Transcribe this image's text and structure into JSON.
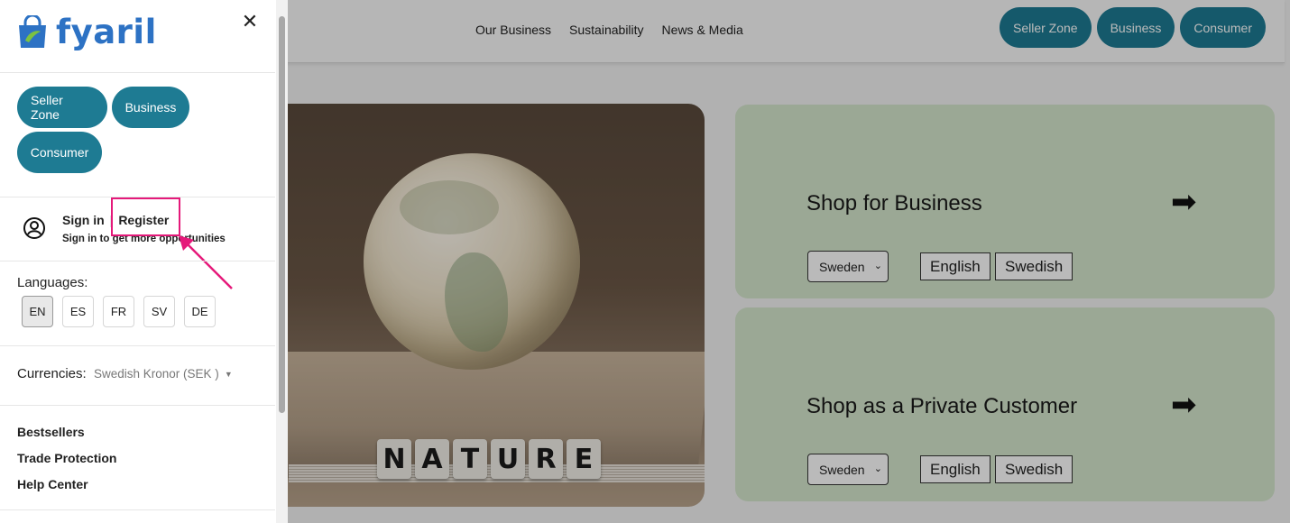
{
  "topnav": {
    "links": [
      "Our Business",
      "Sustainability",
      "News & Media"
    ],
    "zones": [
      "Seller Zone",
      "Business",
      "Consumer"
    ]
  },
  "hero": {
    "dice_letters": [
      "N",
      "A",
      "T",
      "U",
      "R",
      "E"
    ]
  },
  "shop_cards": [
    {
      "title": "Shop for Business",
      "country": "Sweden",
      "lang_en": "English",
      "lang_sv": "Swedish"
    },
    {
      "title": "Shop as a Private Customer",
      "country": "Sweden",
      "lang_en": "English",
      "lang_sv": "Swedish"
    }
  ],
  "drawer": {
    "logo_text": "fyaril",
    "close_glyph": "✕",
    "zones": {
      "seller": "Seller Zone",
      "business": "Business",
      "consumer": "Consumer"
    },
    "signin": "Sign in",
    "separator": "|",
    "register": "Register",
    "signin_sub": "Sign in to get more opportunities",
    "languages_title": "Languages:",
    "languages": [
      "EN",
      "ES",
      "FR",
      "SV",
      "DE"
    ],
    "active_language": "EN",
    "currencies_label": "Currencies:",
    "currency_value": "Swedish Kronor (SEK )",
    "links": [
      "Bestsellers",
      "Trade Protection",
      "Help Center"
    ]
  },
  "colors": {
    "accent_teal": "#1e7b93",
    "logo_blue": "#2d72c4",
    "card_green": "#d5e6cc",
    "highlight_pink": "#e5197a"
  },
  "icons": [
    "shopping-bag-logo-icon",
    "close-icon",
    "user-circle-icon",
    "arrow-right-icon",
    "caret-down-icon"
  ]
}
